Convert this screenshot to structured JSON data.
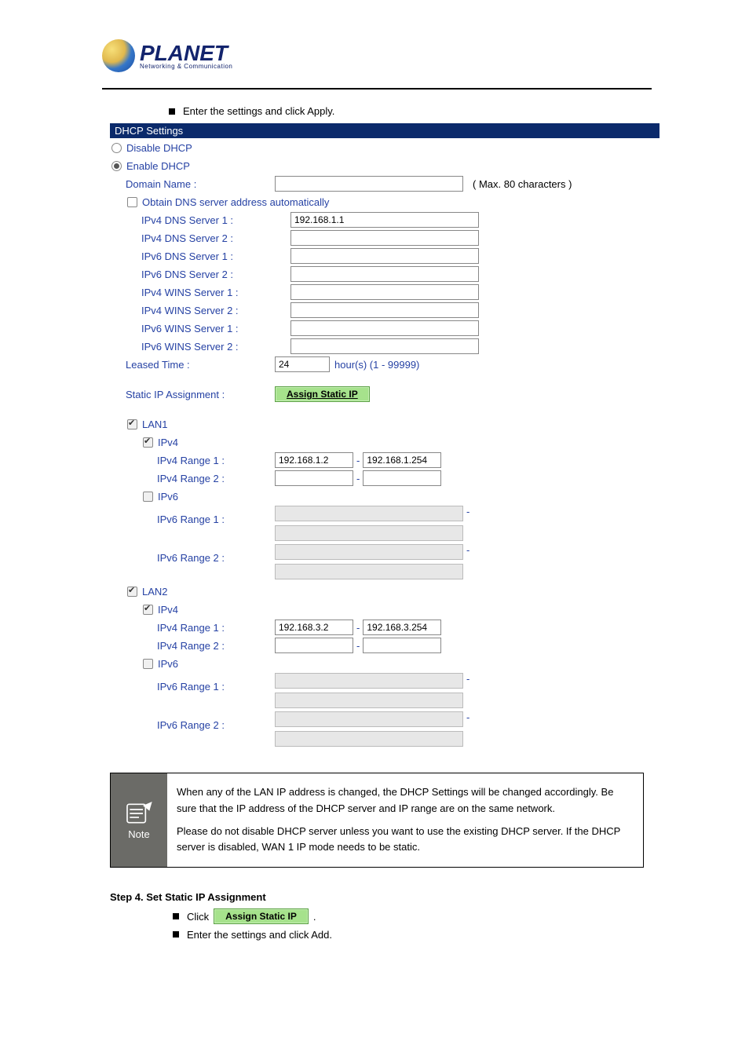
{
  "logo": {
    "brand": "PLANET",
    "tagline": "Networking & Communication"
  },
  "intro_bullet": "Enter the settings and click Apply.",
  "section_header": "DHCP Settings",
  "dhcp": {
    "disable_label": "Disable DHCP",
    "enable_label": "Enable DHCP",
    "domain_label": "Domain Name :",
    "domain_value": "",
    "domain_hint": "( Max. 80 characters )",
    "obtain_dns_label": "Obtain DNS server address automatically",
    "dns": {
      "v4_1_label": "IPv4 DNS Server 1 :",
      "v4_1_value": "192.168.1.1",
      "v4_2_label": "IPv4 DNS Server 2 :",
      "v4_2_value": "",
      "v6_1_label": "IPv6 DNS Server 1 :",
      "v6_1_value": "",
      "v6_2_label": "IPv6 DNS Server 2 :",
      "v6_2_value": ""
    },
    "wins": {
      "v4_1_label": "IPv4 WINS Server 1 :",
      "v4_1_value": "",
      "v4_2_label": "IPv4 WINS Server 2 :",
      "v4_2_value": "",
      "v6_1_label": "IPv6 WINS Server 1 :",
      "v6_1_value": "",
      "v6_2_label": "IPv6 WINS Server 2 :",
      "v6_2_value": ""
    },
    "leased_label": "Leased Time :",
    "leased_value": "24",
    "leased_hint": "hour(s) (1 - 99999)",
    "static_label": "Static IP Assignment :",
    "static_button": "Assign Static IP"
  },
  "lans": [
    {
      "title": "LAN1",
      "ipv4_label": "IPv4",
      "ipv4_on": true,
      "r1_label": "IPv4 Range 1 :",
      "r1_a": "192.168.1.2",
      "r1_b": "192.168.1.254",
      "r2_label": "IPv4 Range 2 :",
      "r2_a": "",
      "r2_b": "",
      "ipv6_label": "IPv6",
      "ipv6_on": false,
      "v6r1_label": "IPv6 Range 1 :",
      "v6r2_label": "IPv6 Range 2 :"
    },
    {
      "title": "LAN2",
      "ipv4_label": "IPv4",
      "ipv4_on": true,
      "r1_label": "IPv4 Range 1 :",
      "r1_a": "192.168.3.2",
      "r1_b": "192.168.3.254",
      "r2_label": "IPv4 Range 2 :",
      "r2_a": "",
      "r2_b": "",
      "ipv6_label": "IPv6",
      "ipv6_on": false,
      "v6r1_label": "IPv6 Range 1 :",
      "v6r2_label": "IPv6 Range 2 :"
    }
  ],
  "note": {
    "icon_label": "Note",
    "line1": "When any of the LAN IP address is changed, the DHCP Settings will be changed accordingly. Be sure that the IP address of the DHCP server and IP range are on the same network.",
    "line2": "Please do not disable DHCP server unless you want to use the existing DHCP server. If the DHCP server is disabled, WAN 1 IP mode needs to be static."
  },
  "step4": {
    "title": "Step 4. Set Static IP Assignment",
    "b1_prefix": "Click ",
    "b1_btn": "Assign Static IP",
    "b1_suffix": ".",
    "b2": "Enter the settings and click Add."
  }
}
